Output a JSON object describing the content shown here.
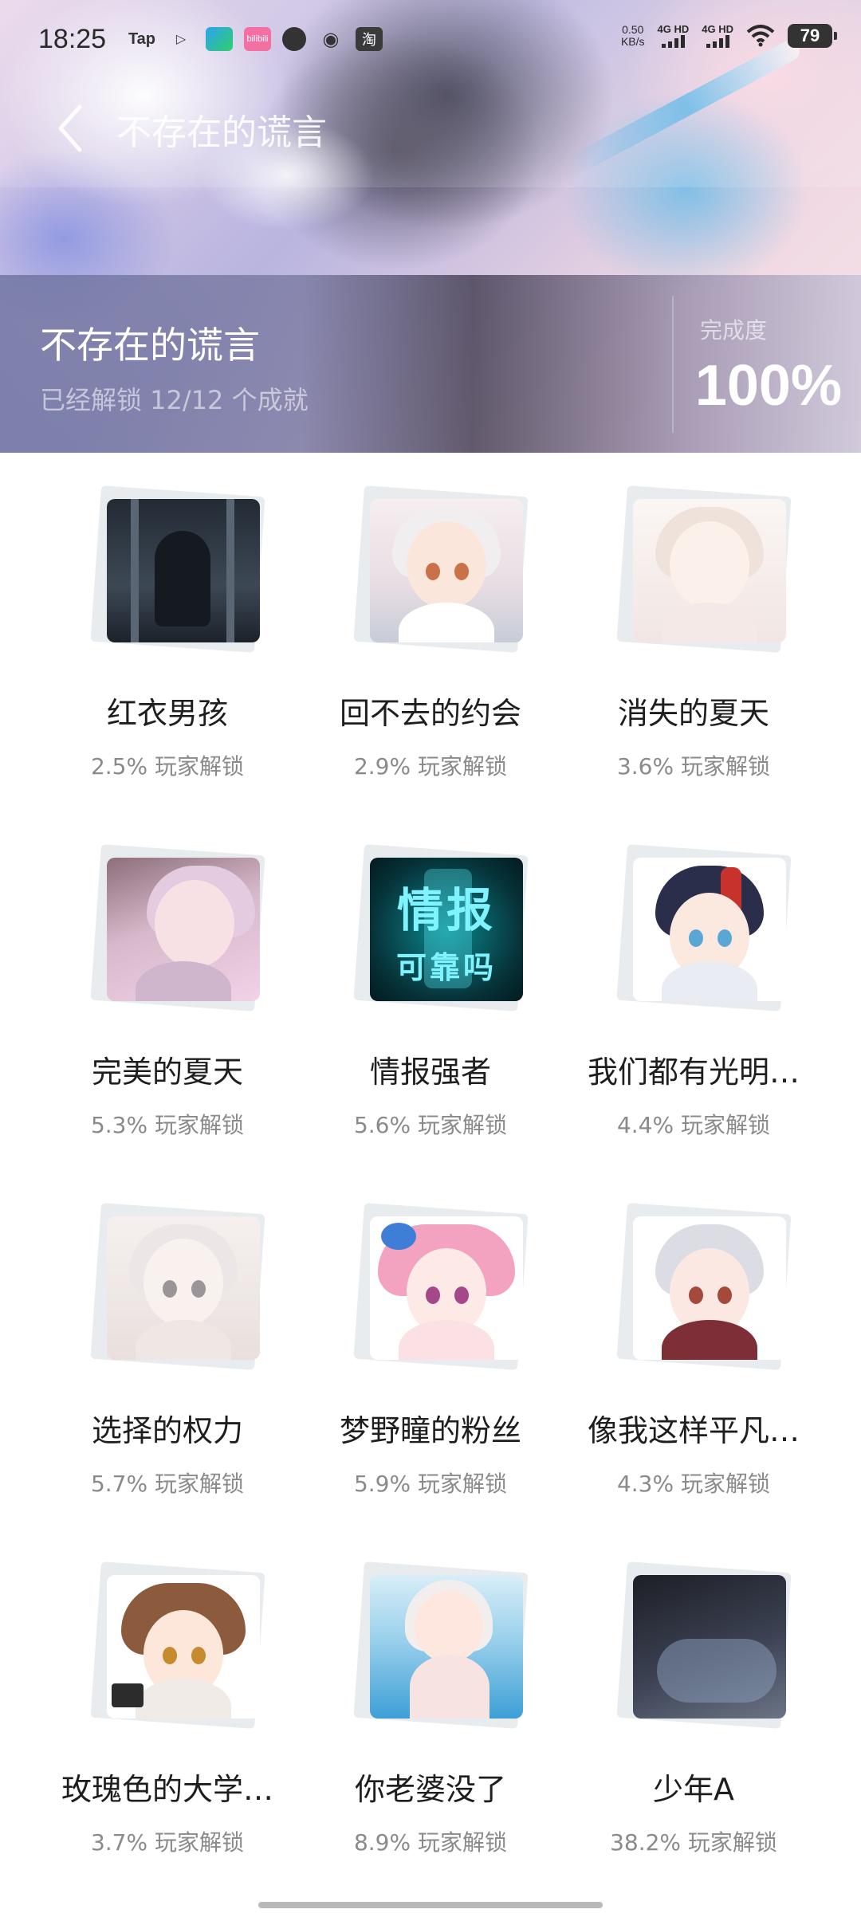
{
  "status_bar": {
    "time": "18:25",
    "app_icons": [
      "Tap",
      "▷",
      "",
      "bilibili",
      "",
      "",
      "淘"
    ],
    "net_speed_value": "0.50",
    "net_speed_unit": "KB/s",
    "sim1": "4G HD",
    "sim2": "4G HD",
    "battery": "79"
  },
  "nav": {
    "title": "不存在的谎言"
  },
  "header": {
    "game_title": "不存在的谎言",
    "unlock_summary": "已经解锁 12/12 个成就",
    "completion_label": "完成度",
    "completion_value": "100%"
  },
  "achievements": [
    {
      "name": "红衣男孩",
      "rate": "2.5% 玩家解锁",
      "thumb": "dark-window"
    },
    {
      "name": "回不去的约会",
      "rate": "2.9% 玩家解锁",
      "thumb": "white-hair-girl"
    },
    {
      "name": "消失的夏天",
      "rate": "3.6% 玩家解锁",
      "thumb": "sketch-girl"
    },
    {
      "name": "完美的夏天",
      "rate": "5.3% 玩家解锁",
      "thumb": "pink-girl-profile"
    },
    {
      "name": "情报强者",
      "rate": "5.6% 玩家解锁",
      "thumb": "info-card",
      "thumb_text_big": "情报",
      "thumb_text_small": "可靠吗"
    },
    {
      "name": "我们都有光明…",
      "rate": "4.4% 玩家解锁",
      "thumb": "glasses-boy"
    },
    {
      "name": "选择的权力",
      "rate": "5.7% 玩家解锁",
      "thumb": "sketch-girl-2"
    },
    {
      "name": "梦野瞳的粉丝",
      "rate": "5.9% 玩家解锁",
      "thumb": "pink-twintail-girl"
    },
    {
      "name": "像我这样平凡…",
      "rate": "4.3% 玩家解锁",
      "thumb": "silver-boy"
    },
    {
      "name": "玫瑰色的大学…",
      "rate": "3.7% 玩家解锁",
      "thumb": "brown-hair-girl"
    },
    {
      "name": "你老婆没了",
      "rate": "8.9% 玩家解锁",
      "thumb": "pool-girl"
    },
    {
      "name": "少年A",
      "rate": "38.2% 玩家解锁",
      "thumb": "dark-night"
    }
  ],
  "colors": {
    "title_text": "#1e1e1e",
    "rate_text": "#8a8a8a",
    "info_cyan": "#7ff4ff"
  }
}
